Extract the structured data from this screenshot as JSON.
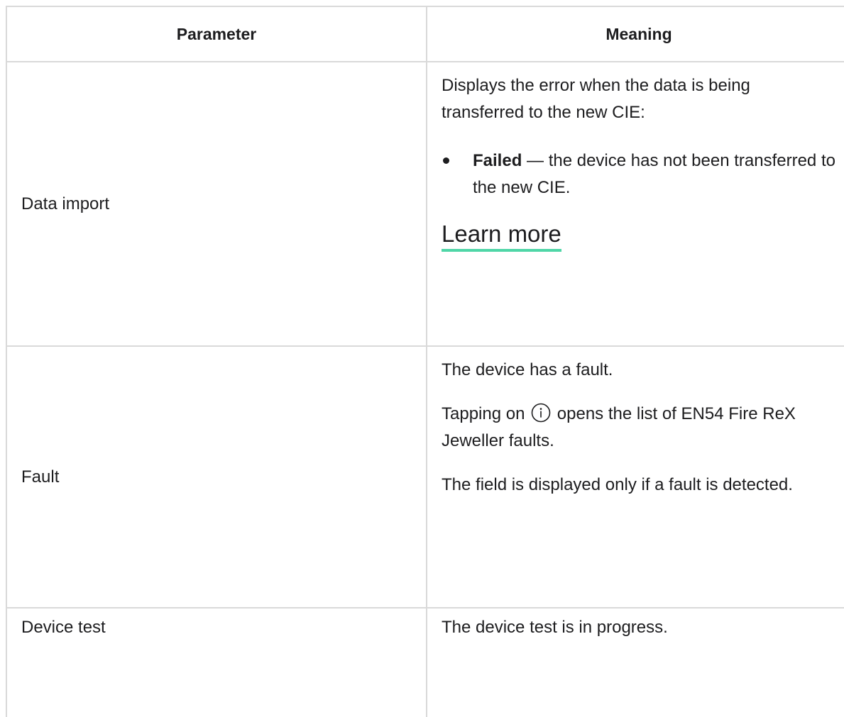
{
  "table": {
    "headers": {
      "parameter": "Parameter",
      "meaning": "Meaning"
    },
    "rows": [
      {
        "parameter": "Data import",
        "meaning_intro": "Displays the error when the data is being transferred to the new CIE:",
        "bullet_bold": "Failed",
        "bullet_text": " — the device has not been transferred to the new CIE.",
        "link_label": "Learn more"
      },
      {
        "parameter": "Fault",
        "meaning_line1": "The device has a fault.",
        "meaning_line2_before_icon": "Tapping on ",
        "icon": "info-circle-icon",
        "meaning_line2_after_icon": " opens the list of EN54 Fire ReX Jeweller faults.",
        "meaning_line3": "The field is displayed only if a fault is detected."
      },
      {
        "parameter": "Device test",
        "meaning_line1": "The device test is in progress."
      }
    ]
  },
  "colors": {
    "border": "#d9d9d9",
    "text": "#1d1d1f",
    "link_underline": "#4fd6a7"
  }
}
